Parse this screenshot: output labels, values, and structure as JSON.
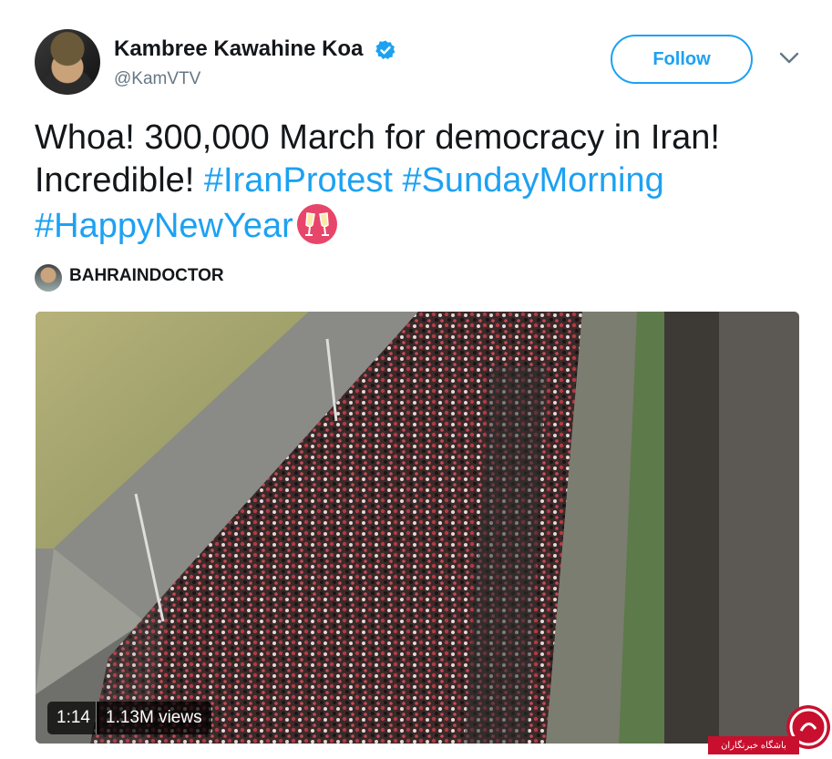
{
  "user": {
    "name": "Kambree Kawahine Koa",
    "handle": "@KamVTV",
    "verified": true
  },
  "follow_button": {
    "label": "Follow"
  },
  "tweet": {
    "text_plain": "Whoa! 300,000 March for democracy in Iran! Incredible!",
    "hashtags": [
      "#IranProtest",
      "#SundayMorning",
      "#HappyNewYear"
    ],
    "emoji": "clinking-glasses-icon"
  },
  "media_credit": {
    "name": "BAHRAINDOCTOR"
  },
  "video": {
    "duration": "1:14",
    "views": "1.13M views"
  },
  "watermark": {
    "text": "باشگاه خبرنگاران"
  },
  "colors": {
    "accent": "#1da1f2",
    "text": "#14171a",
    "secondary": "#657786",
    "watermark": "#c8102e"
  }
}
